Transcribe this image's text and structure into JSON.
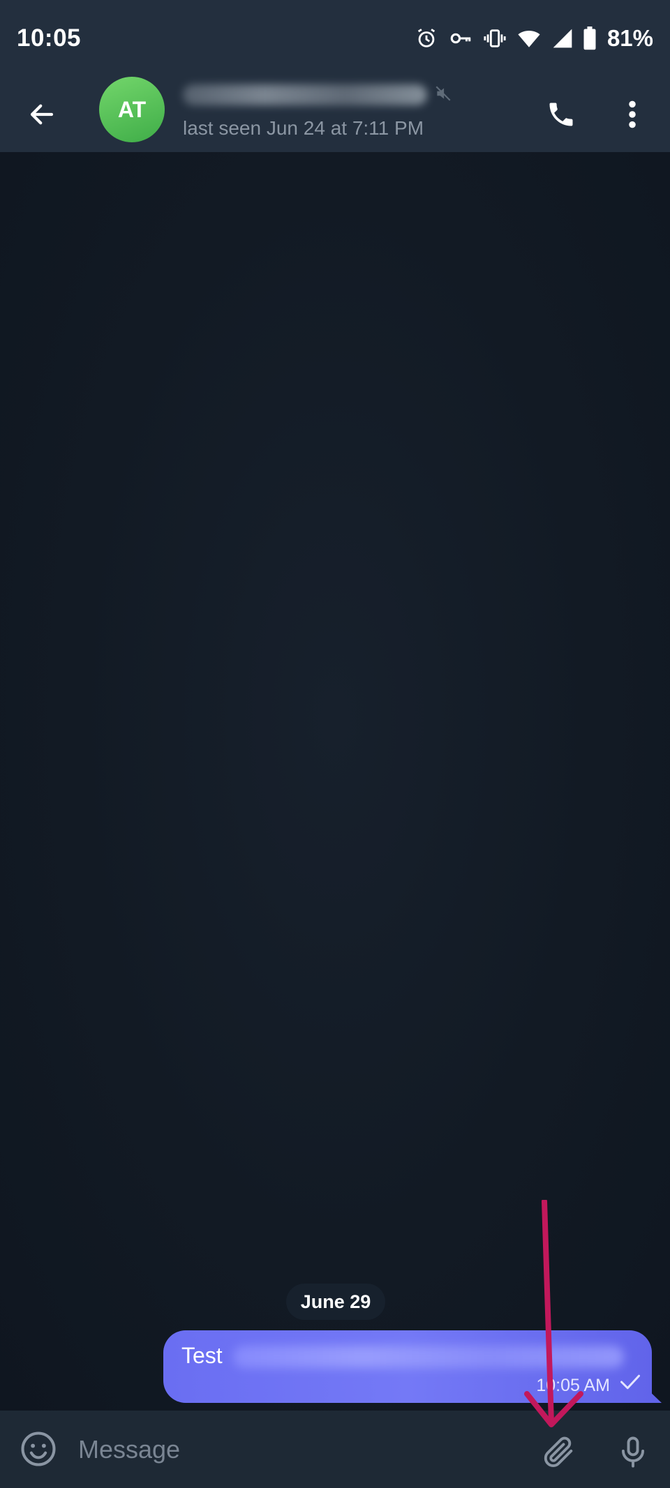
{
  "status_bar": {
    "time": "10:05",
    "battery_percent": "81%",
    "icons": [
      "alarm-icon",
      "vpn-key-icon",
      "vibrate-icon",
      "wifi-icon",
      "signal-icon",
      "battery-icon"
    ]
  },
  "header": {
    "avatar_initials": "AT",
    "avatar_color": "#5cc35a",
    "contact_name": "",
    "last_seen": "last seen Jun 24 at 7:11 PM",
    "muted_icon": "muted-speaker-icon"
  },
  "chat": {
    "date_separator": "June 29",
    "messages": [
      {
        "text": "Test",
        "time": "10:05 AM",
        "status_icon": "check-icon",
        "outgoing": true,
        "bubble_color": "#6a6ef2"
      }
    ]
  },
  "composer": {
    "placeholder": "Message"
  },
  "colors": {
    "accent_annotation": "#c2185b",
    "bar_background": "#232f3e",
    "chat_background": "#121a24"
  }
}
